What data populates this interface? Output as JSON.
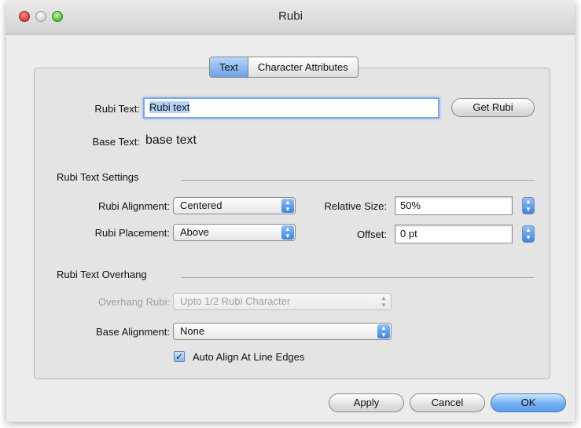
{
  "window": {
    "title": "Rubi"
  },
  "tabs": [
    {
      "label": "Text",
      "selected": true
    },
    {
      "label": "Character Attributes",
      "selected": false
    }
  ],
  "rubi_text": {
    "label": "Rubi Text:",
    "value": "Rubi text",
    "get_button": "Get Rubi"
  },
  "base_text": {
    "label": "Base Text:",
    "value": "base text"
  },
  "settings": {
    "heading": "Rubi Text Settings",
    "alignment": {
      "label": "Rubi Alignment:",
      "value": "Centered"
    },
    "placement": {
      "label": "Rubi Placement:",
      "value": "Above"
    },
    "relative_size": {
      "label": "Relative Size:",
      "value": "50%"
    },
    "offset": {
      "label": "Offset:",
      "value": "0 pt"
    }
  },
  "overhang": {
    "heading": "Rubi Text Overhang",
    "overhang_rubi": {
      "label": "Overhang Rubi:",
      "value": "Upto 1/2 Rubi Character",
      "enabled": false
    },
    "base_alignment": {
      "label": "Base Alignment:",
      "value": "None"
    },
    "auto_align": {
      "label": "Auto Align At Line Edges",
      "checked": true
    }
  },
  "buttons": {
    "apply": "Apply",
    "cancel": "Cancel",
    "ok": "OK"
  },
  "icons": {
    "checkmark": "✓",
    "updown": "▲▼"
  },
  "colors": {
    "accent": "#6aa2e6",
    "close": "#d8342b",
    "maximize": "#49b633"
  }
}
